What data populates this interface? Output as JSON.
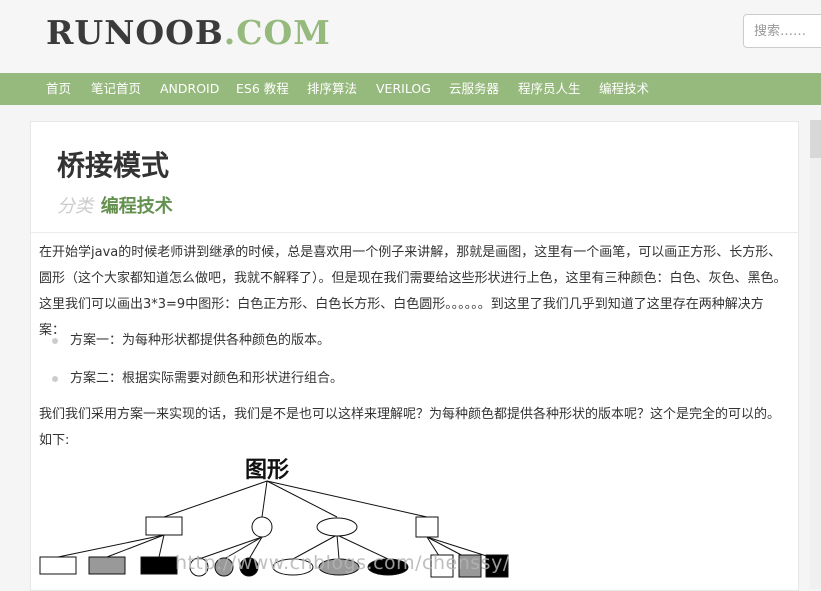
{
  "header": {
    "logo_main": "RUNOOB",
    "logo_suffix": ".COM",
    "search_placeholder": "搜索……"
  },
  "nav": {
    "items": [
      "首页",
      "笔记首页",
      "ANDROID",
      "ES6 教程",
      "排序算法",
      "VERILOG",
      "云服务器",
      "程序员人生",
      "编程技术"
    ]
  },
  "article": {
    "title": "桥接模式",
    "category_label": "分类",
    "category_value": "编程技术",
    "para1": "在开始学java的时候老师讲到继承的时候，总是喜欢用一个例子来讲解，那就是画图，这里有一个画笔，可以画正方形、长方形、圆形（这个大家都知道怎么做吧，我就不解释了）。但是现在我们需要给这些形状进行上色，这里有三种颜色：白色、灰色、黑色。这里我们可以画出3*3=9中图形：白色正方形、白色长方形、白色圆形。。。。。。到这里了我们几乎到知道了这里存在两种解决方案：",
    "list": [
      "方案一：为每种形状都提供各种颜色的版本。",
      "方案二：根据实际需要对颜色和形状进行组合。"
    ],
    "para2": "我们我们采用方案一来实现的话，我们是不是也可以这样来理解呢？为每种颜色都提供各种形状的版本呢？这个是完全的可以的。如下:",
    "diagram_title": "图形",
    "watermark": "http://www.cnblogs.com/chenssy/"
  }
}
